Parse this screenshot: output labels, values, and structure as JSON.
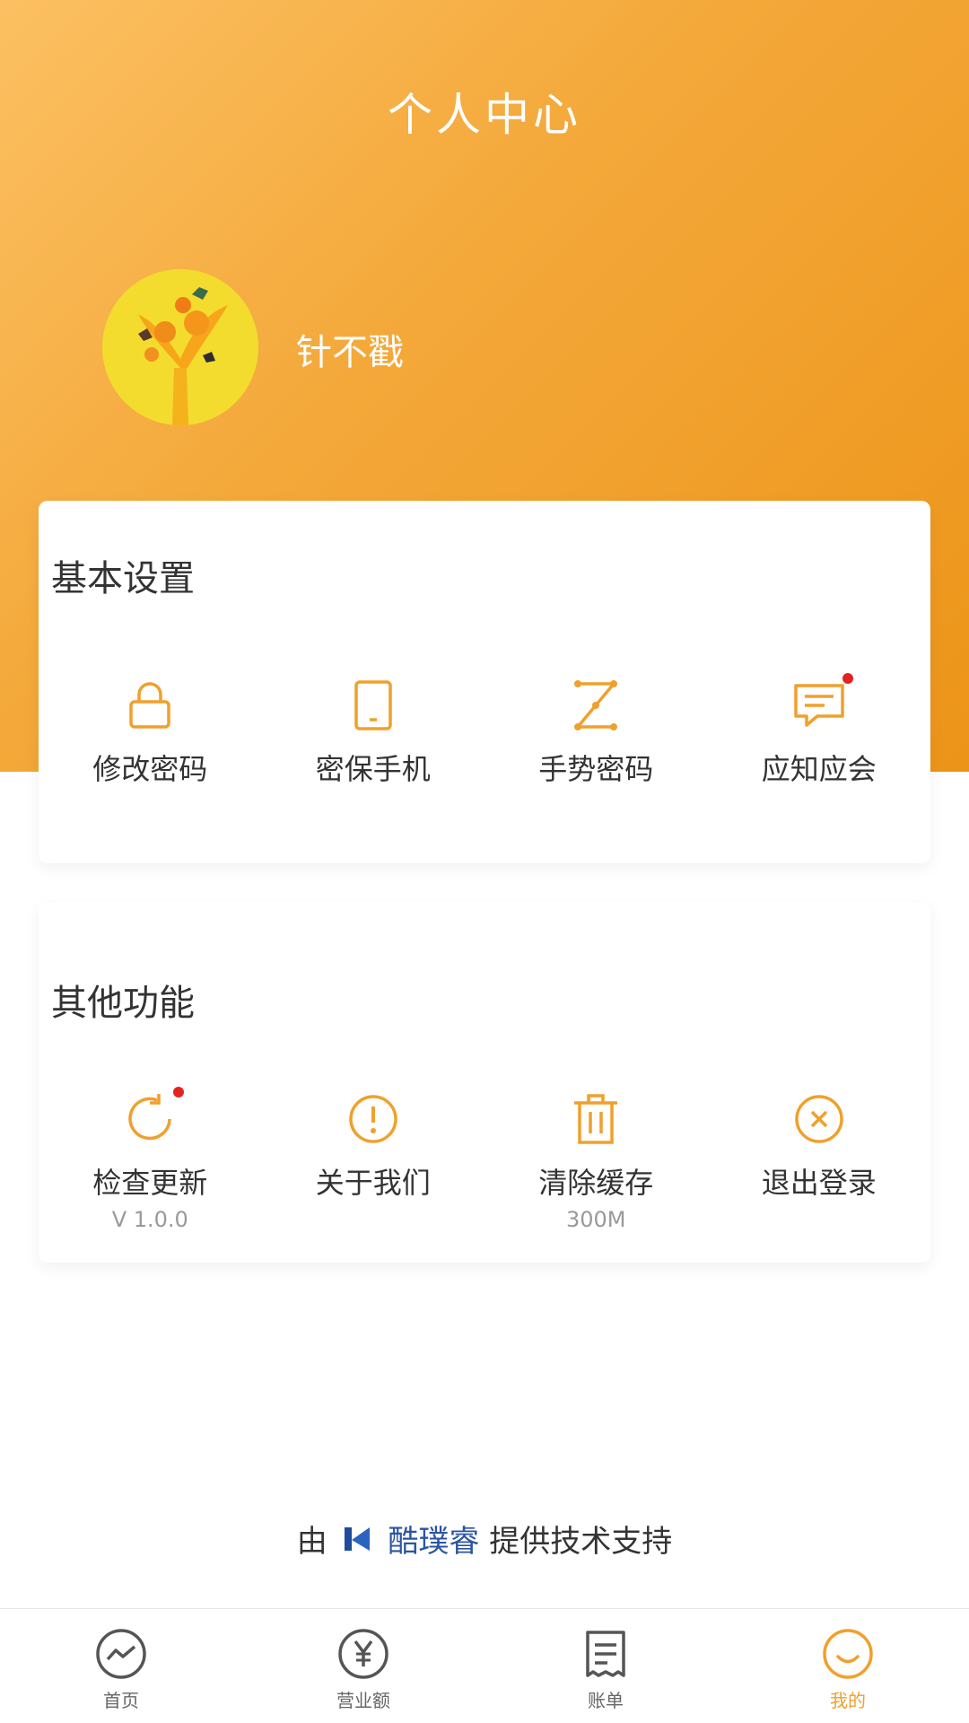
{
  "header": {
    "title": "个人中心"
  },
  "profile": {
    "username": "针不戳"
  },
  "basic_settings": {
    "title": "基本设置",
    "items": [
      {
        "label": "修改密码",
        "icon": "lock-icon",
        "badge": false
      },
      {
        "label": "密保手机",
        "icon": "phone-icon",
        "badge": false
      },
      {
        "label": "手势密码",
        "icon": "gesture-icon",
        "badge": false
      },
      {
        "label": "应知应会",
        "icon": "message-icon",
        "badge": true
      }
    ]
  },
  "other_functions": {
    "title": "其他功能",
    "items": [
      {
        "label": "检查更新",
        "sub": "V 1.0.0",
        "icon": "refresh-icon",
        "badge": true
      },
      {
        "label": "关于我们",
        "sub": "",
        "icon": "info-icon",
        "badge": false
      },
      {
        "label": "清除缓存",
        "sub": "300M",
        "icon": "trash-icon",
        "badge": false
      },
      {
        "label": "退出登录",
        "sub": "",
        "icon": "close-circle-icon",
        "badge": false
      }
    ]
  },
  "credit": {
    "prefix": "由",
    "brand": "酷璞睿",
    "suffix": "提供技术支持"
  },
  "tabbar": {
    "items": [
      {
        "label": "首页",
        "icon": "chart-icon",
        "active": false
      },
      {
        "label": "营业额",
        "icon": "yen-icon",
        "active": false
      },
      {
        "label": "账单",
        "icon": "receipt-icon",
        "active": false
      },
      {
        "label": "我的",
        "icon": "smile-icon",
        "active": true
      }
    ]
  },
  "colors": {
    "accent": "#f0a02c",
    "header_gradient_start": "#fcc062",
    "header_gradient_end": "#ec9418",
    "badge": "#e52222",
    "brand": "#2b55a2"
  }
}
